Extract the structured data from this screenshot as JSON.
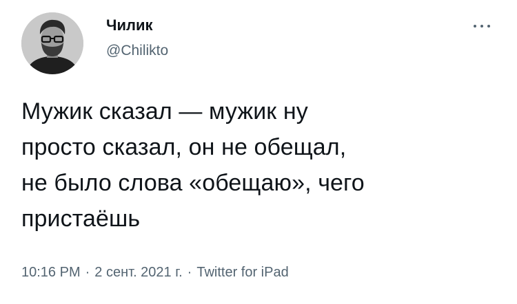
{
  "tweet": {
    "author": {
      "display_name": "Чилик",
      "handle": "@Chilikto",
      "avatar_icon": "user-avatar"
    },
    "more_icon": "more-options-icon",
    "text": "Мужик сказал — мужик ну\nпросто сказал, он не обещал,\nне было слова «обещаю», чего\nпристаёшь",
    "time": "10:16 PM",
    "separator": "·",
    "date": "2 сент. 2021 г.",
    "source": "Twitter for iPad"
  },
  "colors": {
    "text_primary": "#0f1419",
    "text_secondary": "#536471",
    "background": "#ffffff"
  }
}
